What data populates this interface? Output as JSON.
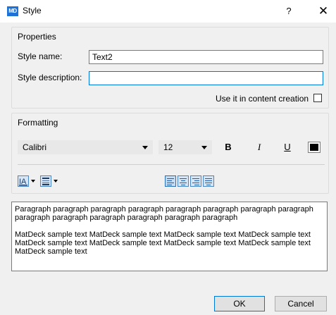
{
  "window": {
    "app_icon_text": "MD",
    "title": "Style",
    "help_label": "?",
    "close_label": "✕"
  },
  "properties": {
    "legend": "Properties",
    "style_name_label": "Style name:",
    "style_name_value": "Text2",
    "style_description_label": "Style description:",
    "style_description_value": "",
    "use_in_content_creation_label": "Use it in content creation",
    "use_in_content_creation_checked": false
  },
  "formatting": {
    "legend": "Formatting",
    "font_family": "Calibri",
    "font_size": "12",
    "bold_label": "B",
    "italic_label": "I",
    "underline_label": "U",
    "font_color": "#000000",
    "text_align_selected": "left",
    "icons": {
      "text_color_dropdown": "text-highlight-icon",
      "border_dropdown": "border-style-icon",
      "align_left": "align-left-icon",
      "align_center": "align-center-icon",
      "align_right": "align-right-icon",
      "align_justify": "align-justify-icon"
    }
  },
  "preview": {
    "paragraph_1": "Paragraph paragraph paragraph paragraph paragraph paragraph paragraph paragraph paragraph paragraph paragraph paragraph paragraph paragraph",
    "paragraph_2": "MatDeck sample text MatDeck sample text MatDeck sample text MatDeck sample text MatDeck sample text MatDeck sample text MatDeck sample text MatDeck sample text MatDeck sample text"
  },
  "buttons": {
    "ok_label": "OK",
    "cancel_label": "Cancel"
  }
}
